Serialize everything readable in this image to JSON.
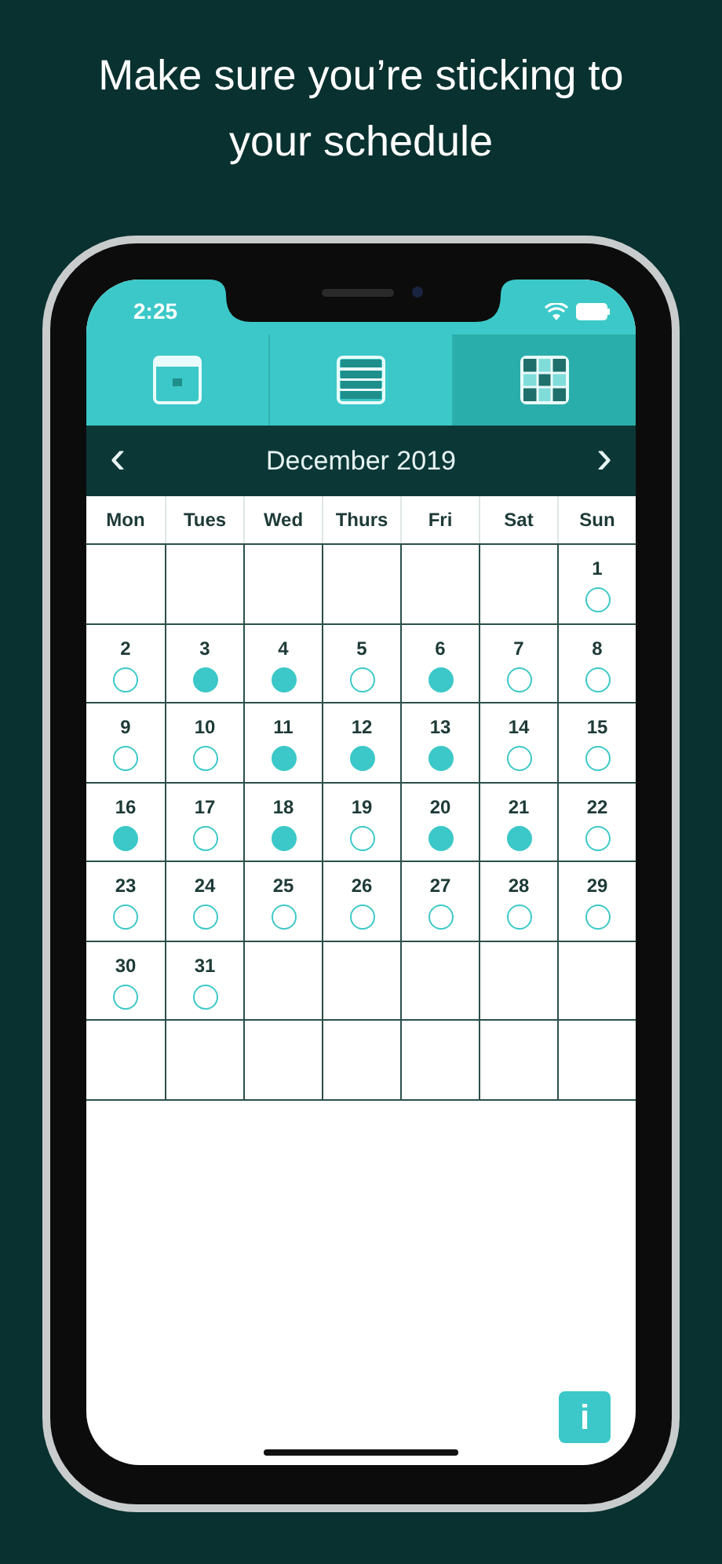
{
  "headline": "Make sure you’re sticking to your schedule",
  "status_bar": {
    "time": "2:25"
  },
  "tabs": [
    {
      "kind": "day",
      "selected": false
    },
    {
      "kind": "list",
      "selected": false
    },
    {
      "kind": "month",
      "selected": true
    }
  ],
  "month_header": {
    "title": "December 2019",
    "prev": "‹",
    "next": "›"
  },
  "weekdays": [
    "Mon",
    "Tues",
    "Wed",
    "Thurs",
    "Fri",
    "Sat",
    "Sun"
  ],
  "cells": [
    {
      "kind": "blank"
    },
    {
      "kind": "blank"
    },
    {
      "kind": "blank"
    },
    {
      "kind": "blank"
    },
    {
      "kind": "blank"
    },
    {
      "kind": "blank"
    },
    {
      "kind": "day",
      "label": "1",
      "done": false
    },
    {
      "kind": "day",
      "label": "2",
      "done": false
    },
    {
      "kind": "day",
      "label": "3",
      "done": true
    },
    {
      "kind": "day",
      "label": "4",
      "done": true
    },
    {
      "kind": "day",
      "label": "5",
      "done": false
    },
    {
      "kind": "day",
      "label": "6",
      "done": true
    },
    {
      "kind": "day",
      "label": "7",
      "done": false
    },
    {
      "kind": "day",
      "label": "8",
      "done": false
    },
    {
      "kind": "day",
      "label": "9",
      "done": false
    },
    {
      "kind": "day",
      "label": "10",
      "done": false
    },
    {
      "kind": "day",
      "label": "11",
      "done": true
    },
    {
      "kind": "day",
      "label": "12",
      "done": true
    },
    {
      "kind": "day",
      "label": "13",
      "done": true
    },
    {
      "kind": "day",
      "label": "14",
      "done": false
    },
    {
      "kind": "day",
      "label": "15",
      "done": false
    },
    {
      "kind": "day",
      "label": "16",
      "done": true
    },
    {
      "kind": "day",
      "label": "17",
      "done": false
    },
    {
      "kind": "day",
      "label": "18",
      "done": true
    },
    {
      "kind": "day",
      "label": "19",
      "done": false
    },
    {
      "kind": "day",
      "label": "20",
      "done": true
    },
    {
      "kind": "day",
      "label": "21",
      "done": true
    },
    {
      "kind": "day",
      "label": "22",
      "done": false
    },
    {
      "kind": "day",
      "label": "23",
      "done": false
    },
    {
      "kind": "day",
      "label": "24",
      "done": false
    },
    {
      "kind": "day",
      "label": "25",
      "done": false
    },
    {
      "kind": "day",
      "label": "26",
      "done": false
    },
    {
      "kind": "day",
      "label": "27",
      "done": false
    },
    {
      "kind": "day",
      "label": "28",
      "done": false
    },
    {
      "kind": "day",
      "label": "29",
      "done": false
    },
    {
      "kind": "day",
      "label": "30",
      "done": false
    },
    {
      "kind": "day",
      "label": "31",
      "done": false
    },
    {
      "kind": "blank"
    },
    {
      "kind": "blank"
    },
    {
      "kind": "blank"
    },
    {
      "kind": "blank"
    },
    {
      "kind": "blank"
    },
    {
      "kind": "blank"
    },
    {
      "kind": "blank"
    },
    {
      "kind": "blank"
    },
    {
      "kind": "blank"
    },
    {
      "kind": "blank"
    },
    {
      "kind": "blank"
    },
    {
      "kind": "blank"
    }
  ],
  "info_button": {
    "label": "i"
  }
}
